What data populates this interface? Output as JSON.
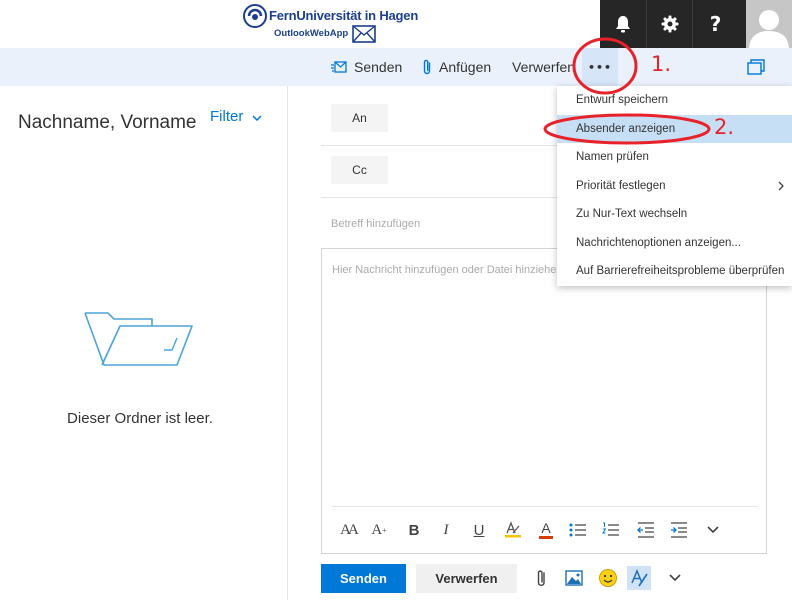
{
  "header": {
    "logo": {
      "name": "FernUniversität in Hagen",
      "subtitle": "OutlookWebApp",
      "brand_color": "#1b3f8e"
    },
    "topbar_bg": "#262626",
    "icons": [
      "bell-icon",
      "gear-icon",
      "help-icon",
      "user-avatar-icon"
    ],
    "help_label": "?"
  },
  "cmdbar": {
    "bg": "#eaf1fb",
    "send_label": "Senden",
    "attach_label": "Anfügen",
    "discard_label": "Verwerfen",
    "more_label": "•••"
  },
  "leftpane": {
    "folder_title": "Nachname, Vorname",
    "filter_label": "Filter",
    "empty_text": "Dieser Ordner ist leer."
  },
  "compose": {
    "to_label": "An",
    "cc_label": "Cc",
    "subject_placeholder": "Betreff hinzufügen",
    "body_placeholder": "Hier Nachricht hinzufügen oder Datei hinziehen",
    "send_label": "Senden",
    "discard_label": "Verwerfen",
    "format": {
      "font_size_label": "AA",
      "grow_label": "A",
      "bold_label": "B",
      "italic_label": "I",
      "underline_label": "U",
      "font_color_label": "A"
    },
    "accent": "#0078d7"
  },
  "menu": {
    "items": [
      {
        "label": "Entwurf speichern"
      },
      {
        "label": "Absender anzeigen"
      },
      {
        "label": "Namen prüfen"
      },
      {
        "label": "Priorität festlegen"
      },
      {
        "label": "Zu Nur-Text wechseln"
      },
      {
        "label": "Nachrichtenoptionen anzeigen..."
      },
      {
        "label": "Auf Barrierefreiheitsprobleme überprüfen"
      }
    ],
    "highlight_color": "#c7dff5"
  },
  "annotations": {
    "step1": "1.",
    "step2": "2.",
    "color": "#e8222b"
  }
}
